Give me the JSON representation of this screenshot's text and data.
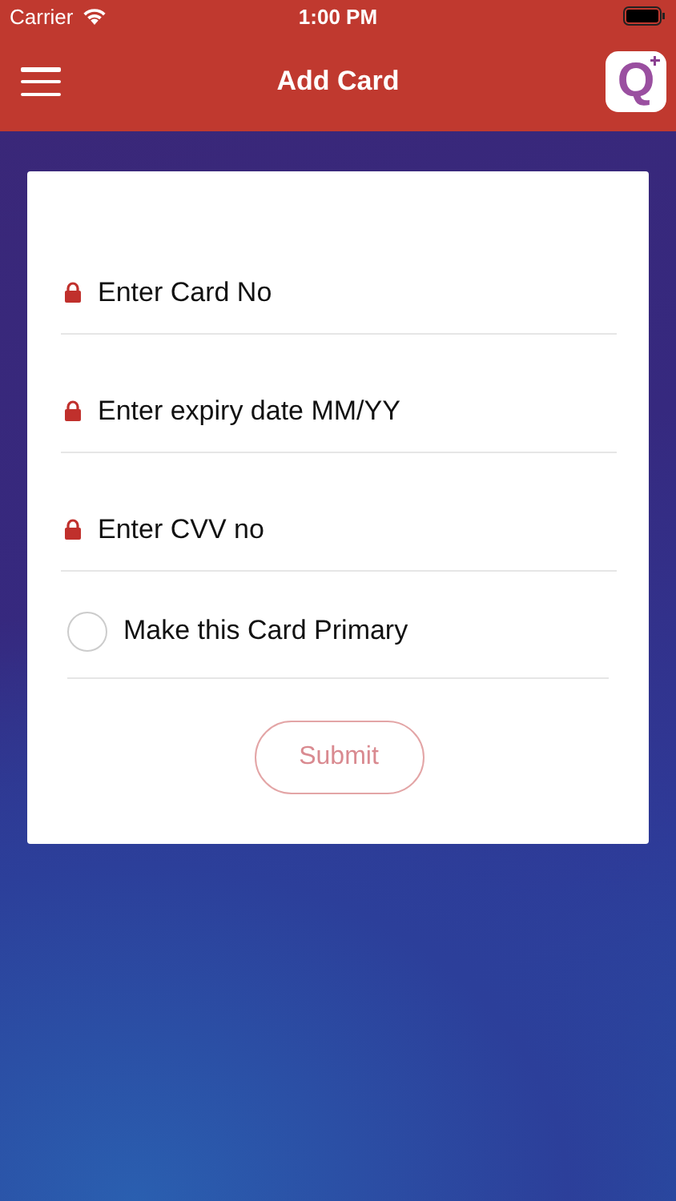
{
  "status_bar": {
    "carrier": "Carrier",
    "time": "1:00 PM"
  },
  "nav_bar": {
    "title": "Add Card",
    "logo_letter": "Q"
  },
  "fields": [
    {
      "placeholder": "Enter Card No"
    },
    {
      "placeholder": "Enter expiry date MM/YY"
    },
    {
      "placeholder": "Enter CVV no"
    }
  ],
  "primary_option": {
    "label": "Make this Card Primary",
    "checked": false
  },
  "submit_button": {
    "label": "Submit",
    "disabled": true
  }
}
